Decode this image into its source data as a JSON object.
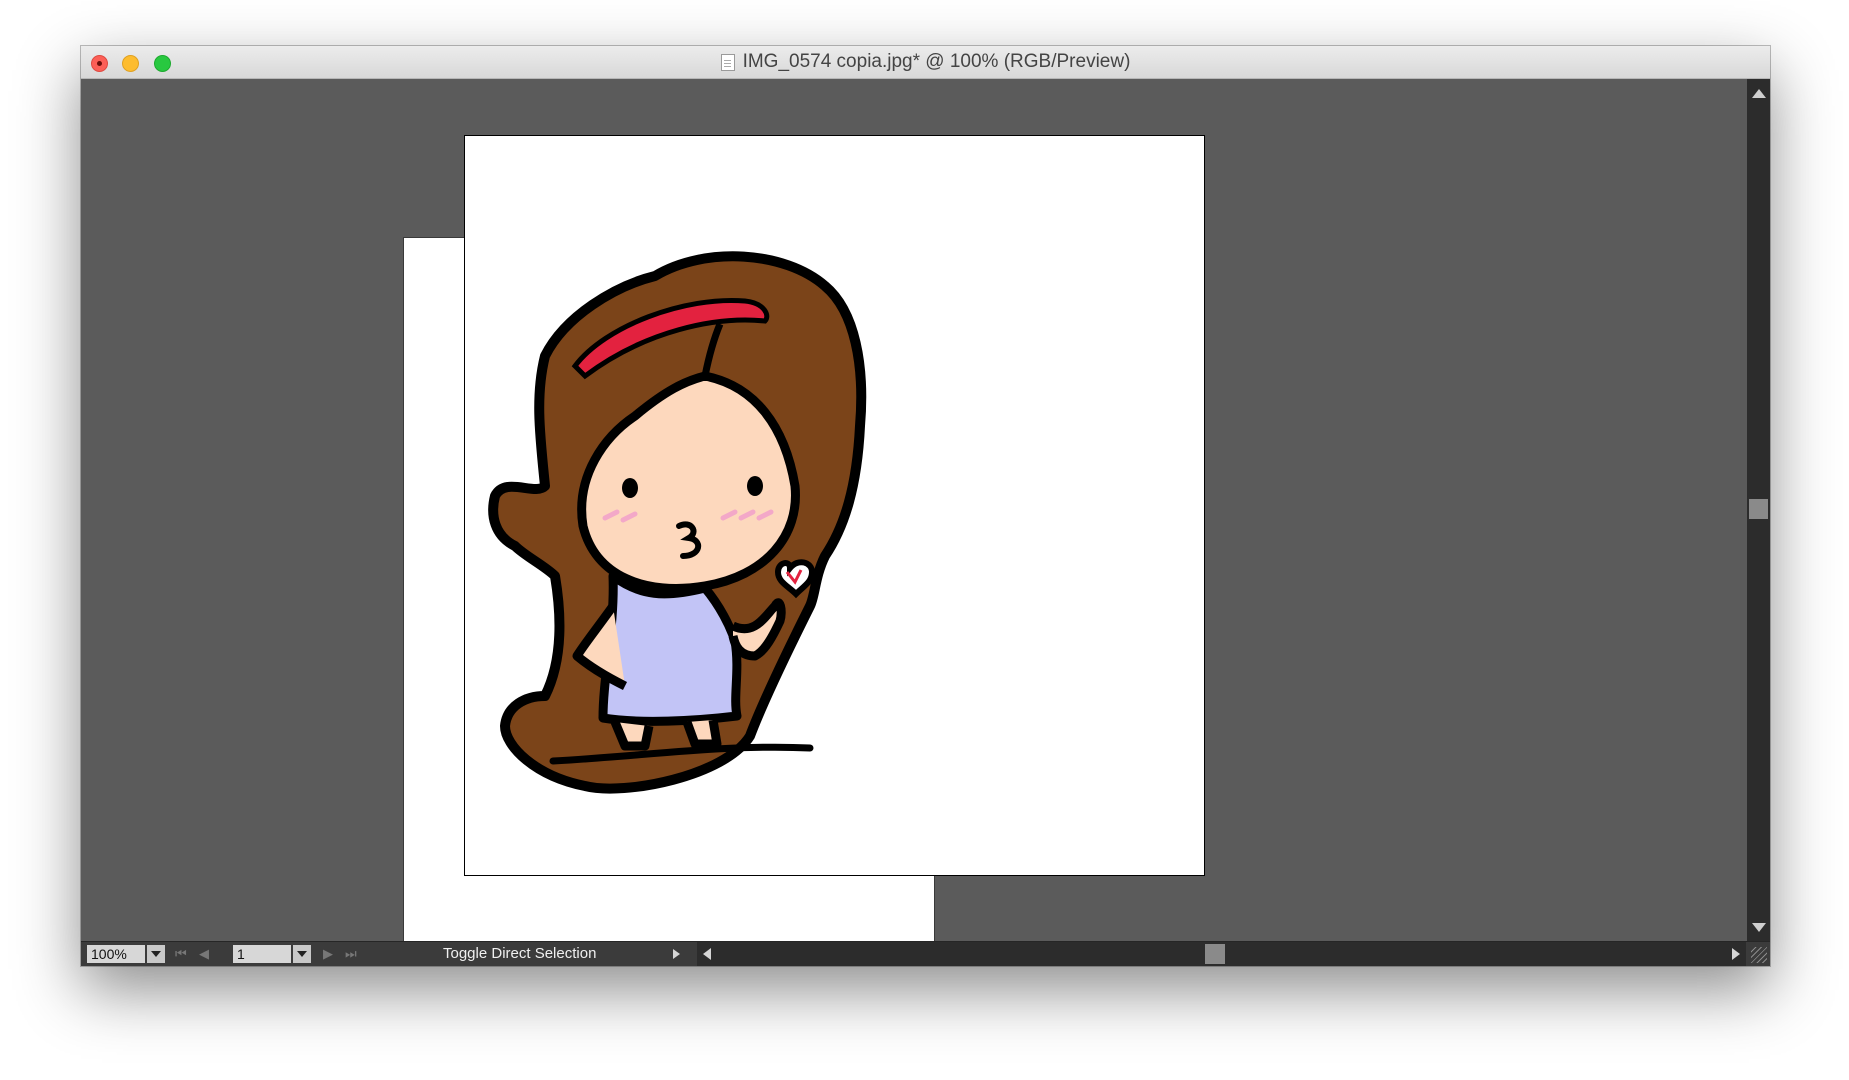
{
  "window": {
    "title": "IMG_0574 copia.jpg* @ 100% (RGB/Preview)",
    "file_icon": "document-icon"
  },
  "statusbar": {
    "zoom": "100%",
    "page": "1",
    "tool_label": "Toggle Direct Selection",
    "icons": {
      "first": "first-page-icon",
      "prev": "previous-page-icon",
      "next": "next-page-icon",
      "last": "last-page-icon"
    }
  },
  "colors": {
    "canvas": "#5b5b5b",
    "hair": "#7b4419",
    "headband": "#e3223f",
    "skin": "#fdd8bd",
    "dress": "#c2c4f6",
    "blush": "#f3a8c8",
    "heart": "#e3223f"
  }
}
